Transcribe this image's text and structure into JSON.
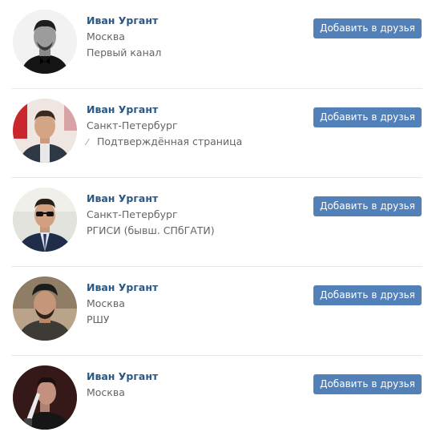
{
  "colors": {
    "accent": "#5181b8",
    "name_link": "#2a5885",
    "secondary_text": "#656565",
    "divider": "#e7e8ec"
  },
  "people": [
    {
      "name": "Иван Ургант",
      "city": "Москва",
      "extra": "Первый канал",
      "extra_icon": "",
      "button": "Добавить в друзья"
    },
    {
      "name": "Иван Ургант",
      "city": "Санкт-Петербург",
      "extra": "Подтверждённая страница",
      "extra_icon": "verified-icon",
      "button": "Добавить в друзья"
    },
    {
      "name": "Иван Ургант",
      "city": "Санкт-Петербург",
      "extra": "РГИСИ (бывш. СПбГАТИ)",
      "extra_icon": "",
      "button": "Добавить в друзья"
    },
    {
      "name": "Иван Ургант",
      "city": "Москва",
      "extra": "РШУ",
      "extra_icon": "",
      "button": "Добавить в друзья"
    },
    {
      "name": "Иван Ургант",
      "city": "Москва",
      "extra": "",
      "extra_icon": "",
      "button": "Добавить в друзья"
    }
  ]
}
